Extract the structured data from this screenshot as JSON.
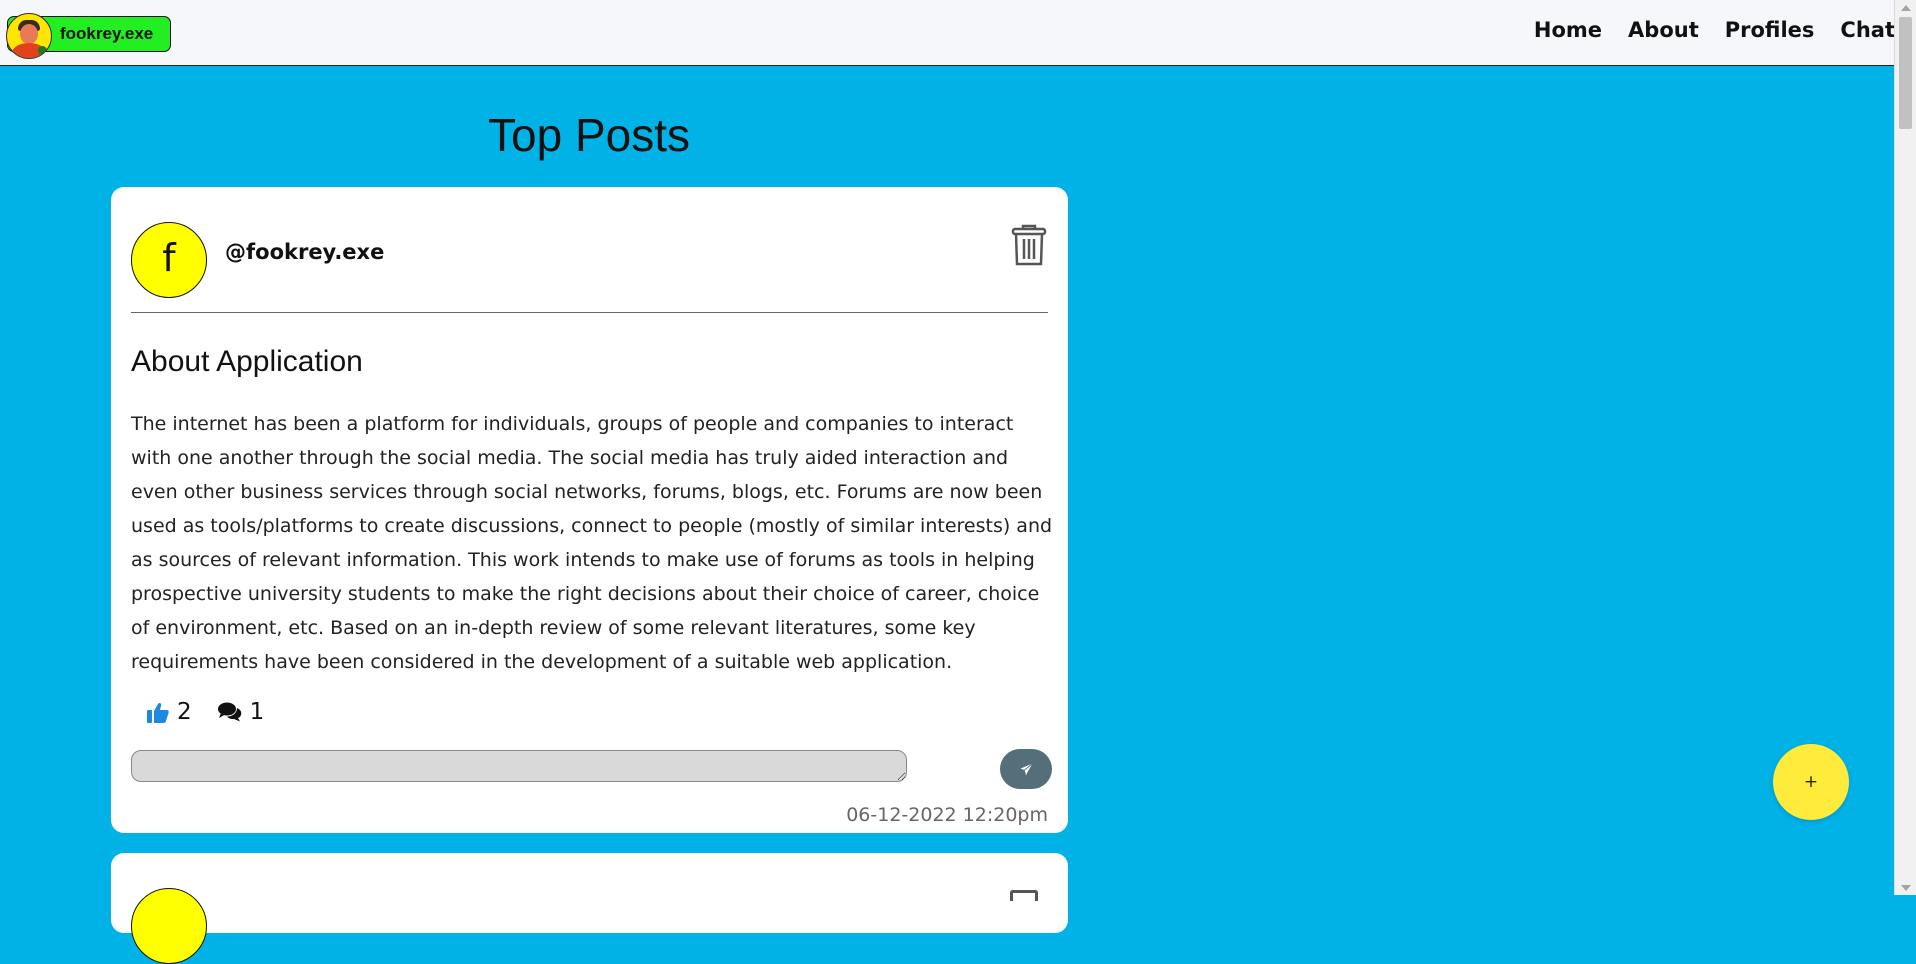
{
  "brand": {
    "name": "fookrey.exe"
  },
  "nav": {
    "links": [
      "Home",
      "About",
      "Profiles",
      "Chat"
    ]
  },
  "page": {
    "title": "Top Posts"
  },
  "post": {
    "avatar_letter": "f",
    "username": "@fookrey.exe",
    "title": "About Application",
    "body": "The internet has been a platform for individuals, groups of people and companies to interact with one another through the social media. The social media has truly aided interaction and even other business services through social networks, forums, blogs, etc. Forums are now been used as tools/platforms to create discussions, connect to people (mostly of similar interests) and as sources of relevant information. This work intends to make use of forums as tools in helping prospective university students to make the right decisions about their choice of career, choice of environment, etc. Based on an in-depth review of some relevant literatures, some key requirements have been considered in the development of a suitable web application.",
    "likes": "2",
    "comments": "1",
    "comment_placeholder": "",
    "timestamp": "06-12-2022 12:20pm"
  },
  "fab": {
    "label": "+"
  },
  "colors": {
    "background": "#00b2e6",
    "avatar": "#ffff00",
    "brand": "#22ee22",
    "like": "#1e88e5",
    "send": "#546e7a",
    "fab": "#ffeb3b"
  },
  "icons": {
    "delete": "trash-icon",
    "like": "thumbs-up-icon",
    "comment": "comments-icon",
    "send": "paper-plane-icon"
  }
}
